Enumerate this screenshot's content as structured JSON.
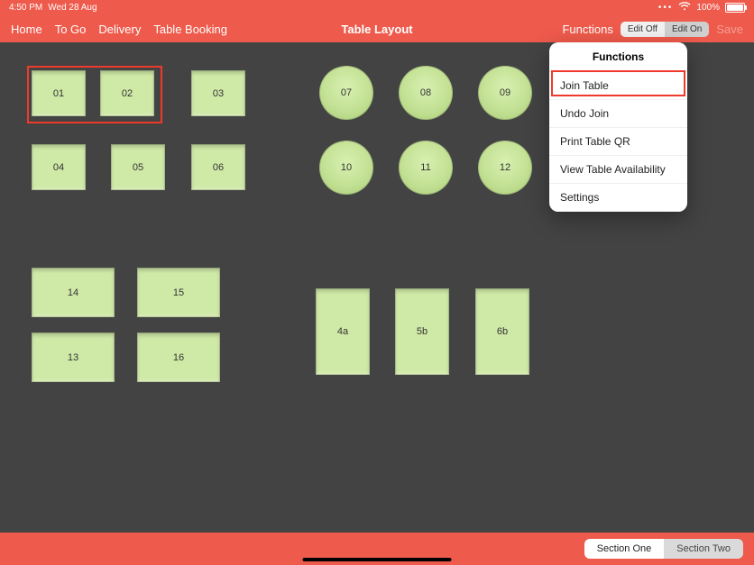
{
  "status": {
    "time": "4:50 PM",
    "date": "Wed 28 Aug",
    "battery_pct": "100%"
  },
  "nav": {
    "home": "Home",
    "togo": "To Go",
    "delivery": "Delivery",
    "booking": "Table Booking",
    "title": "Table Layout",
    "functions_label": "Functions",
    "edit_off": "Edit Off",
    "edit_on": "Edit On",
    "save": "Save"
  },
  "tables": {
    "t01": "01",
    "t02": "02",
    "t03": "03",
    "t04": "04",
    "t05": "05",
    "t06": "06",
    "t07": "07",
    "t08": "08",
    "t09": "09",
    "t10": "10",
    "t11": "11",
    "t12": "12",
    "t13": "13",
    "t14": "14",
    "t15": "15",
    "t16": "16",
    "t4a": "4a",
    "t5b": "5b",
    "t6b": "6b"
  },
  "dropdown": {
    "title": "Functions",
    "items": {
      "join": "Join Table",
      "undo": "Undo Join",
      "print": "Print Table QR",
      "avail": "View Table Availability",
      "settings": "Settings"
    }
  },
  "sections": {
    "one": "Section One",
    "two": "Section Two"
  }
}
